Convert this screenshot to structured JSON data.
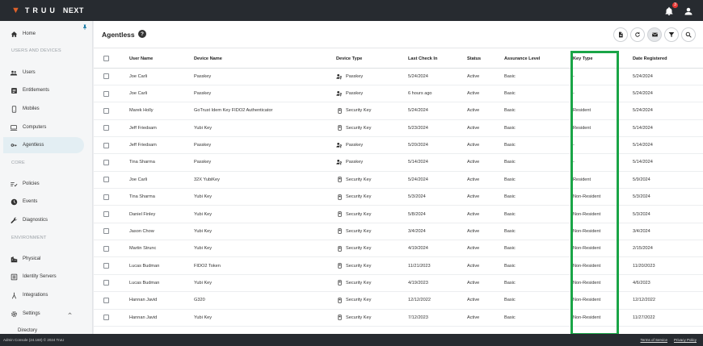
{
  "app": {
    "logo_text": "TRUU",
    "logo_suffix": "NEXT",
    "notification_count": "3",
    "accent_color": "#e0622b",
    "highlight_color": "#1aa547"
  },
  "sidebar": {
    "items": [
      {
        "label": "Home",
        "icon": "home-icon"
      },
      {
        "label": "Users",
        "icon": "users-icon"
      },
      {
        "label": "Entitlements",
        "icon": "entitlements-icon"
      },
      {
        "label": "Mobiles",
        "icon": "mobile-icon"
      },
      {
        "label": "Computers",
        "icon": "computer-icon"
      },
      {
        "label": "Agentless",
        "icon": "key-icon"
      },
      {
        "label": "Policies",
        "icon": "policies-icon"
      },
      {
        "label": "Events",
        "icon": "events-icon"
      },
      {
        "label": "Diagnostics",
        "icon": "wrench-icon"
      },
      {
        "label": "Physical",
        "icon": "building-icon"
      },
      {
        "label": "Identity Servers",
        "icon": "server-icon"
      },
      {
        "label": "Integrations",
        "icon": "integrations-icon"
      },
      {
        "label": "Settings",
        "icon": "gear-icon"
      },
      {
        "label": "Directory",
        "icon": ""
      }
    ],
    "sections": {
      "users_devices": "USERS AND DEVICES",
      "core": "CORE",
      "environment": "ENVIRONMENT"
    }
  },
  "page": {
    "title": "Agentless"
  },
  "table": {
    "columns": [
      "User Name",
      "Device Name",
      "Device Type",
      "Last Check In",
      "Status",
      "Assurance Level",
      "Key Type",
      "Date Registered"
    ],
    "rows": [
      {
        "user": "Joe Carli",
        "device": "Passkey",
        "type": "Passkey",
        "checkin": "5/24/2024",
        "status": "Active",
        "assurance": "Basic",
        "key": "-",
        "registered": "5/24/2024"
      },
      {
        "user": "Joe Carli",
        "device": "Passkey",
        "type": "Passkey",
        "checkin": "6 hours ago",
        "status": "Active",
        "assurance": "Basic",
        "key": "-",
        "registered": "5/24/2024"
      },
      {
        "user": "Marek Holly",
        "device": "GoTrust Idem Key FIDO2 Authenticator",
        "type": "Security Key",
        "checkin": "5/24/2024",
        "status": "Active",
        "assurance": "Basic",
        "key": "Resident",
        "registered": "5/24/2024"
      },
      {
        "user": "Jeff Friedsam",
        "device": "Yubi Key",
        "type": "Security Key",
        "checkin": "5/23/2024",
        "status": "Active",
        "assurance": "Basic",
        "key": "Resident",
        "registered": "5/14/2024"
      },
      {
        "user": "Jeff Friedsam",
        "device": "Passkey",
        "type": "Passkey",
        "checkin": "5/20/2024",
        "status": "Active",
        "assurance": "Basic",
        "key": "-",
        "registered": "5/14/2024"
      },
      {
        "user": "Tina Sharma",
        "device": "Passkey",
        "type": "Passkey",
        "checkin": "5/14/2024",
        "status": "Active",
        "assurance": "Basic",
        "key": "-",
        "registered": "5/14/2024"
      },
      {
        "user": "Joe Carli",
        "device": "32X YubiKey",
        "type": "Security Key",
        "checkin": "5/24/2024",
        "status": "Active",
        "assurance": "Basic",
        "key": "Resident",
        "registered": "5/9/2024"
      },
      {
        "user": "Tina Sharma",
        "device": "Yubi Key",
        "type": "Security Key",
        "checkin": "5/3/2024",
        "status": "Active",
        "assurance": "Basic",
        "key": "Non-Resident",
        "registered": "5/3/2024"
      },
      {
        "user": "Daniel Finley",
        "device": "Yubi Key",
        "type": "Security Key",
        "checkin": "5/8/2024",
        "status": "Active",
        "assurance": "Basic",
        "key": "Non-Resident",
        "registered": "5/3/2024"
      },
      {
        "user": "Jason Chow",
        "device": "Yubi Key",
        "type": "Security Key",
        "checkin": "3/4/2024",
        "status": "Active",
        "assurance": "Basic",
        "key": "Non-Resident",
        "registered": "3/4/2024"
      },
      {
        "user": "Martin Strunc",
        "device": "Yubi Key",
        "type": "Security Key",
        "checkin": "4/19/2024",
        "status": "Active",
        "assurance": "Basic",
        "key": "Non-Resident",
        "registered": "2/15/2024"
      },
      {
        "user": "Lucas Budman",
        "device": "FIDO2 Token",
        "type": "Security Key",
        "checkin": "11/21/2023",
        "status": "Active",
        "assurance": "Basic",
        "key": "Non-Resident",
        "registered": "11/20/2023"
      },
      {
        "user": "Lucas Budman",
        "device": "Yubi Key",
        "type": "Security Key",
        "checkin": "4/19/2023",
        "status": "Active",
        "assurance": "Basic",
        "key": "Non-Resident",
        "registered": "4/6/2023"
      },
      {
        "user": "Hannan Javid",
        "device": "G320",
        "type": "Security Key",
        "checkin": "12/12/2022",
        "status": "Active",
        "assurance": "Basic",
        "key": "Non-Resident",
        "registered": "12/12/2022"
      },
      {
        "user": "Hannan Javid",
        "device": "Yubi Key",
        "type": "Security Key",
        "checkin": "7/12/2023",
        "status": "Active",
        "assurance": "Basic",
        "key": "Non-Resident",
        "registered": "11/27/2022"
      }
    ]
  },
  "footer": {
    "left": "Admin Console (24.160) © 2024 TruU",
    "terms": "Terms of Service",
    "privacy": "Privacy Policy"
  }
}
